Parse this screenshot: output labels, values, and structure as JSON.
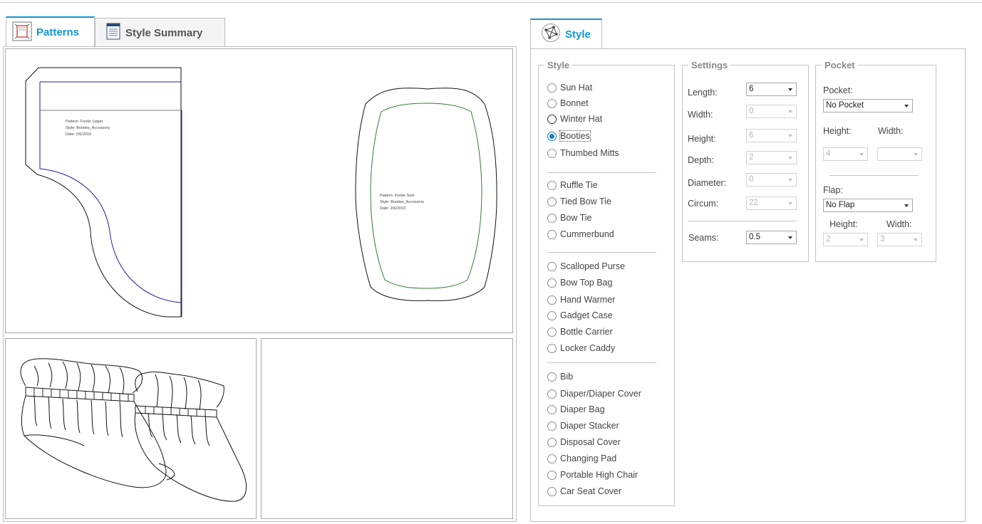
{
  "tabs": {
    "patterns": "Patterns",
    "style_summary": "Style Summary",
    "style": "Style"
  },
  "patterns": {
    "upper": {
      "pattern": "Pattern: Footie Upper",
      "style": "Style: Booties_Accessory",
      "date": "Date: 2/6/2019"
    },
    "sole": {
      "pattern": "Pattern: Footie Sole",
      "style": "Style: Booties_Accessory",
      "date": "Date: 2/6/2019"
    }
  },
  "style_group": {
    "legend": "Style",
    "options": [
      {
        "label": "Sun Hat",
        "checked": false
      },
      {
        "label": "Bonnet",
        "checked": false
      },
      {
        "label": "Winter Hat",
        "checked": false
      },
      {
        "label": "Booties",
        "checked": true
      },
      {
        "label": "Thumbed Mitts",
        "checked": false
      },
      {
        "label": "Ruffle Tie",
        "checked": false
      },
      {
        "label": "Tied Bow Tie",
        "checked": false
      },
      {
        "label": "Bow Tie",
        "checked": false
      },
      {
        "label": "Cummerbund",
        "checked": false
      },
      {
        "label": "Scalloped Purse",
        "checked": false
      },
      {
        "label": "Bow Top Bag",
        "checked": false
      },
      {
        "label": "Hand Warmer",
        "checked": false
      },
      {
        "label": "Gadget Case",
        "checked": false
      },
      {
        "label": "Bottle Carrier",
        "checked": false
      },
      {
        "label": "Locker Caddy",
        "checked": false
      },
      {
        "label": "Bib",
        "checked": false
      },
      {
        "label": "Diaper/Diaper Cover",
        "checked": false
      },
      {
        "label": "Diaper Bag",
        "checked": false
      },
      {
        "label": "Diaper Stacker",
        "checked": false
      },
      {
        "label": "Disposal Cover",
        "checked": false
      },
      {
        "label": "Changing Pad",
        "checked": false
      },
      {
        "label": "Portable High Chair",
        "checked": false
      },
      {
        "label": "Car Seat Cover",
        "checked": false
      }
    ]
  },
  "settings": {
    "legend": "Settings",
    "length": {
      "label": "Length:",
      "value": "6",
      "enabled": true
    },
    "width": {
      "label": "Width:",
      "value": "0",
      "enabled": false
    },
    "height": {
      "label": "Height:",
      "value": "6",
      "enabled": false
    },
    "depth": {
      "label": "Depth:",
      "value": "2",
      "enabled": false
    },
    "diameter": {
      "label": "Diameter:",
      "value": "0",
      "enabled": false
    },
    "circum": {
      "label": "Circum:",
      "value": "22",
      "enabled": false
    },
    "seams": {
      "label": "Seams:",
      "value": "0.5",
      "enabled": true
    }
  },
  "pocket": {
    "legend": "Pocket",
    "pocket_label": "Pocket:",
    "pocket_value": "No Pocket",
    "height_label": "Height:",
    "height_value": "4",
    "width_label": "Width:",
    "width_value": "",
    "flap_label": "Flap:",
    "flap_value": "No Flap",
    "flap_height_label": "Height:",
    "flap_height_value": "2",
    "flap_width_label": "Width:",
    "flap_width_value": "3"
  },
  "colors": {
    "accent": "#1496d6",
    "pattern_blue": "#1a1aa0",
    "pattern_green": "#2e7d32",
    "pattern_purple": "#6a1b9a"
  }
}
